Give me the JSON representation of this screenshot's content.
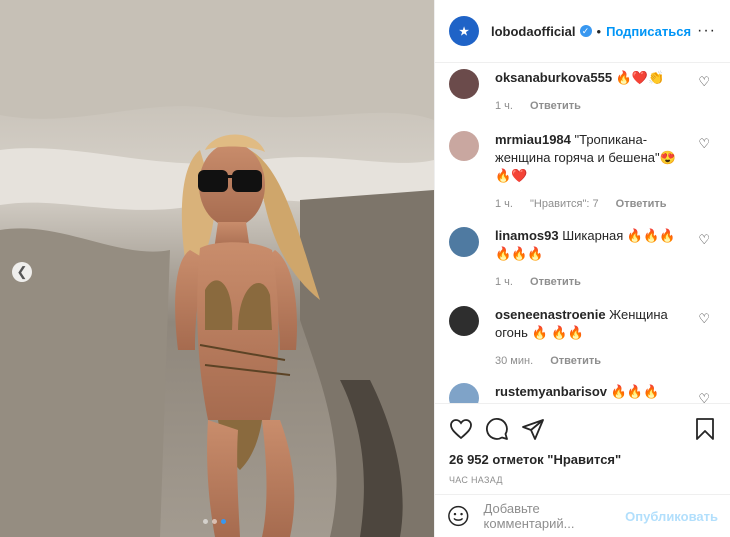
{
  "header": {
    "username": "lobodaofficial",
    "separator": "•",
    "follow_label": "Подписаться",
    "more": "···"
  },
  "comments": [
    {
      "user": "oksanaburkova555",
      "text": " 🔥❤️👏",
      "time": "1 ч.",
      "likes": "",
      "reply": "Ответить",
      "avatar_color": "#6b4b4b"
    },
    {
      "user": "mrmiau1984",
      "text": " \"Тропикана-женщина горяча и бешена\"😍🔥❤️",
      "time": "1 ч.",
      "likes": "\"Нравится\": 7",
      "reply": "Ответить",
      "avatar_color": "#c9a7a0"
    },
    {
      "user": "linamos93",
      "text": " Шикарная 🔥🔥🔥🔥🔥🔥",
      "time": "1 ч.",
      "likes": "",
      "reply": "Ответить",
      "avatar_color": "#4f7aa1"
    },
    {
      "user": "oseneenastroenie",
      "text": " Женщина огонь 🔥 🔥🔥",
      "time": "30 мин.",
      "likes": "",
      "reply": "Ответить",
      "avatar_color": "#2e2e2e"
    },
    {
      "user": "rustemyanbarisov",
      "text": " 🔥🔥🔥",
      "time": "",
      "likes": "",
      "reply": "",
      "avatar_color": "#7fa3c8"
    }
  ],
  "actions": {
    "likes_text": "26 952 отметок \"Нравится\"",
    "time_ago": "ЧАС НАЗАД"
  },
  "add_comment": {
    "placeholder": "Добавьте комментарий...",
    "publish_label": "Опубликовать"
  },
  "icons": {
    "like": "heart-icon",
    "comment": "comment-icon",
    "share": "share-icon",
    "save": "bookmark-icon",
    "emoji": "emoji-icon",
    "prev": "chevron-left-icon",
    "verified": "verified-badge-icon"
  },
  "colors": {
    "follow": "#0095f6",
    "publish_disabled": "#b2dffc",
    "verified": "#3897f0"
  }
}
